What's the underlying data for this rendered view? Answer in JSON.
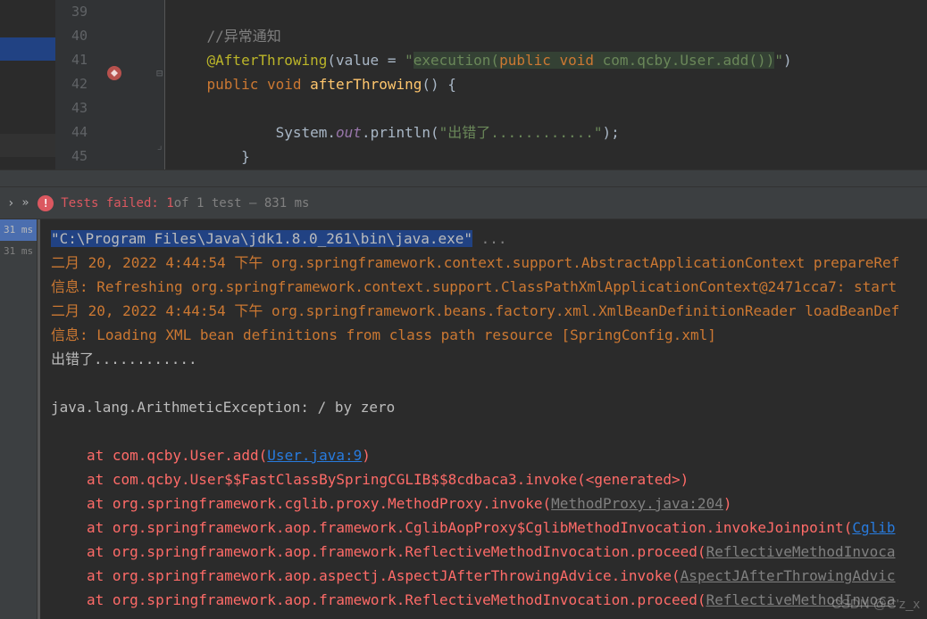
{
  "editor": {
    "lines": {
      "39": "39",
      "40": "40",
      "41": "41",
      "42": "42",
      "43": "43",
      "44": "44",
      "45": "45"
    },
    "comment40": "//异常通知",
    "annotation41": "@AfterThrowing",
    "paren41_open": "(value = ",
    "quote": "\"",
    "exec_start": "execution(",
    "exec_keywords": "public void",
    "exec_rest": " com.qcby.User.add())",
    "paren41_close": ")",
    "public42": "public",
    "void42": "void",
    "method42": "afterThrowing",
    "params42": "() {",
    "sys44": "            System.",
    "out44": "out",
    "println44": ".println(",
    "string44": "\"出错了............\"",
    "end44": ");",
    "brace45": "        }"
  },
  "testbar": {
    "failed_label": "Tests failed:",
    "count": "1",
    "of_text": " of 1 test – 831 ms"
  },
  "sidebar": {
    "item1": "31 ms",
    "item2": "31 ms"
  },
  "console": {
    "cmd": "\"C:\\Program Files\\Java\\jdk1.8.0_261\\bin\\java.exe\"",
    "cmd_dots": " ...",
    "line1_date": "二月 20, 2022 4:44:54 下午 ",
    "line1_class": "org.springframework.context.support.AbstractApplicationContext prepareRef",
    "line2_prefix": "信息: ",
    "line2_text": "Refreshing org.springframework.context.support.ClassPathXmlApplicationContext@2471cca7: start",
    "line3_date": "二月 20, 2022 4:44:54 下午 ",
    "line3_class": "org.springframework.beans.factory.xml.XmlBeanDefinitionReader loadBeanDef",
    "line4_prefix": "信息: ",
    "line4_text": "Loading XML bean definitions from class path resource [SpringConfig.xml]",
    "line5": "出错了............",
    "exception": "java.lang.ArithmeticException: / by zero",
    "stack1_pre": "at com.qcby.User.add(",
    "stack1_link": "User.java:9",
    "stack1_post": ")",
    "stack2": "at com.qcby.User$$FastClassBySpringCGLIB$$8cdbaca3.invoke(<generated>)",
    "stack3_pre": "at org.springframework.cglib.proxy.MethodProxy.invoke(",
    "stack3_link": "MethodProxy.java:204",
    "stack3_post": ")",
    "stack4_pre": "at org.springframework.aop.framework.CglibAopProxy$CglibMethodInvocation.invokeJoinpoint(",
    "stack4_link": "Cglib",
    "stack5_pre": "at org.springframework.aop.framework.ReflectiveMethodInvocation.proceed(",
    "stack5_link": "ReflectiveMethodInvoca",
    "stack6_pre": "at org.springframework.aop.aspectj.AspectJAfterThrowingAdvice.invoke(",
    "stack6_link": "AspectJAfterThrowingAdvic",
    "stack7_pre": "at org.springframework.aop.framework.ReflectiveMethodInvocation.proceed(",
    "stack7_link": "ReflectiveMethodInvoca"
  },
  "watermark": "CSDN @C'z_x"
}
